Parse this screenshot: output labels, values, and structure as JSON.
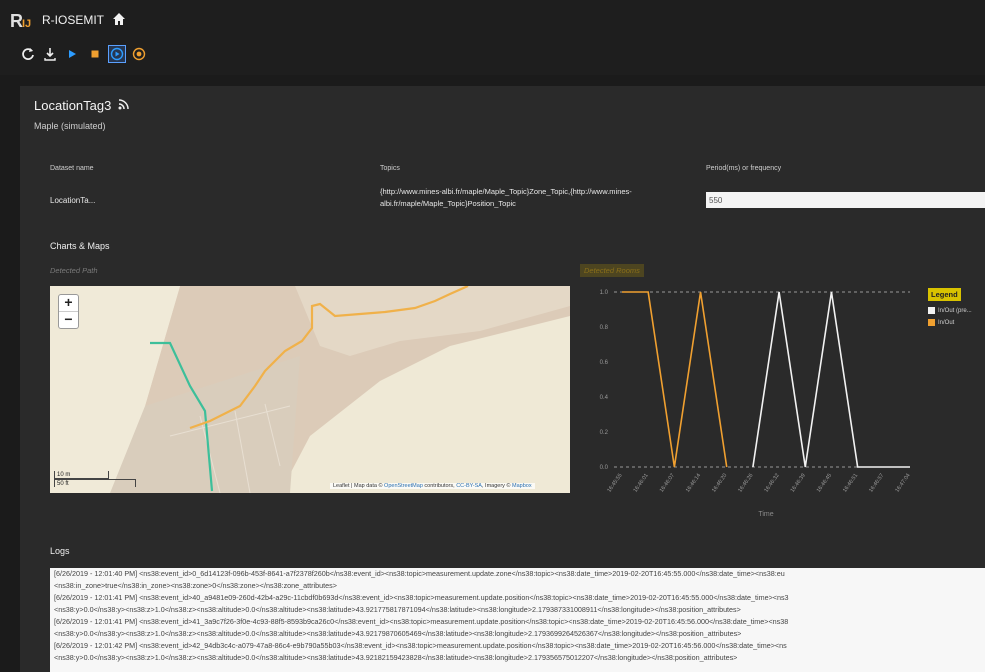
{
  "app": {
    "title": "R-IOSEMIT",
    "logo_letter": "R",
    "logo_sub": "IJ"
  },
  "toolbar": {
    "icons": [
      "refresh-icon",
      "download-icon",
      "play-icon",
      "stop-icon",
      "step-play-icon",
      "record-icon"
    ]
  },
  "dashboard": {
    "title": "LocationTag3",
    "subtitle": "Maple  (simulated)"
  },
  "dataset": {
    "headers": {
      "name": "Dataset name",
      "topics": "Topics",
      "period": "Period(ms) or frequency"
    },
    "name": "LocationTa...",
    "topics": "{http://www.mines-albi.fr/maple/Maple_Topic}Zone_Topic,{http://www.mines-albi.fr/maple/Maple_Topic}Position_Topic",
    "period": "550"
  },
  "charts_section": {
    "title": "Charts & Maps",
    "map_label": "Detected Path",
    "chart_label": "Detected Rooms"
  },
  "map": {
    "zoom_in": "+",
    "zoom_out": "−",
    "scale_top": "10 m",
    "scale_bottom": "50 ft",
    "attribution_prefix": "Leaflet | Map data © ",
    "attribution_osm": "OpenStreetMap",
    "attribution_mid": " contributors, ",
    "attribution_cc": "CC-BY-SA",
    "attribution_imagery": ", Imagery © ",
    "attribution_mapbox": "Mapbox",
    "colors": {
      "path_teal": "#3dbf9a",
      "path_orange": "#f0b14a"
    }
  },
  "chart_data": {
    "type": "line",
    "title": "",
    "xlabel": "Time",
    "ylabel": "",
    "ylim": [
      0,
      1
    ],
    "yticks": [
      "0.0",
      "0.2",
      "0.4",
      "0.6",
      "0.8",
      "1.0"
    ],
    "categories": [
      "16:45:55",
      "16:46:01",
      "16:46:07",
      "16:46:14",
      "16:46:20",
      "16:46:26",
      "16:46:32",
      "16:46:39",
      "16:46:45",
      "16:46:51",
      "16:46:57",
      "16:47:04"
    ],
    "series": [
      {
        "name": "In/Out (pre...",
        "color": "#f2f2f2",
        "values": [
          null,
          null,
          null,
          null,
          null,
          0,
          1,
          0,
          1,
          0,
          0,
          0
        ]
      },
      {
        "name": "In/Out",
        "color": "#f0a030",
        "values": [
          1,
          1,
          0,
          1,
          0,
          null,
          null,
          null,
          null,
          null,
          null,
          null
        ]
      }
    ],
    "legend": {
      "title": "Legend",
      "placement": "right"
    }
  },
  "logs": {
    "title": "Logs",
    "lines": [
      "[6/26/2019 - 12:01:40 PM] <ns38:event_id>0_6d14123f-096b-453f-8641-a7f2378f260b</ns38:event_id><ns38:topic>measurement.update.zone</ns38:topic><ns38:date_time>2019-02-20T16:45:55.000</ns38:date_time><ns38:eu",
      "<ns38:in_zone>true</ns38:in_zone><ns38:zone>0</ns38:zone></ns38:zone_attributes>",
      "[6/26/2019 - 12:01:41 PM] <ns38:event_id>40_a9481e09-260d-42b4-a29c-11cbdf0b693d</ns38:event_id><ns38:topic>measurement.update.position</ns38:topic><ns38:date_time>2019-02-20T16:45:55.000</ns38:date_time><ns3",
      "<ns38:y>0.0</ns38:y><ns38:z>1.0</ns38:z><ns38:altitude>0.0</ns38:altitude><ns38:latitude>43.921775817871094</ns38:latitude><ns38:longitude>2.179387331008911</ns38:longitude></ns38:position_attributes>",
      "[6/26/2019 - 12:01:41 PM] <ns38:event_id>41_3a9c7f26-3f0e-4c93-88f5-8593b9ca26c0</ns38:event_id><ns38:topic>measurement.update.position</ns38:topic><ns38:date_time>2019-02-20T16:45:56.000</ns38:date_time><ns38",
      "<ns38:y>0.0</ns38:y><ns38:z>1.0</ns38:z><ns38:altitude>0.0</ns38:altitude><ns38:latitude>43.92179870605469</ns38:latitude><ns38:longitude>2.1793699264526367</ns38:longitude></ns38:position_attributes>",
      "[6/26/2019 - 12:01:42 PM] <ns38:event_id>42_94db3c4c-a079-47a8-86c4-e9b790a55b03</ns38:event_id><ns38:topic>measurement.update.position</ns38:topic><ns38:date_time>2019-02-20T16:45:56.000</ns38:date_time><ns",
      "<ns38:y>0.0</ns38:y><ns38:z>1.0</ns38:z><ns38:altitude>0.0</ns38:altitude><ns38:latitude>43.92182159423828</ns38:latitude><ns38:longitude>2.179356575012207</ns38:longitude></ns38:position_attributes>"
    ]
  }
}
